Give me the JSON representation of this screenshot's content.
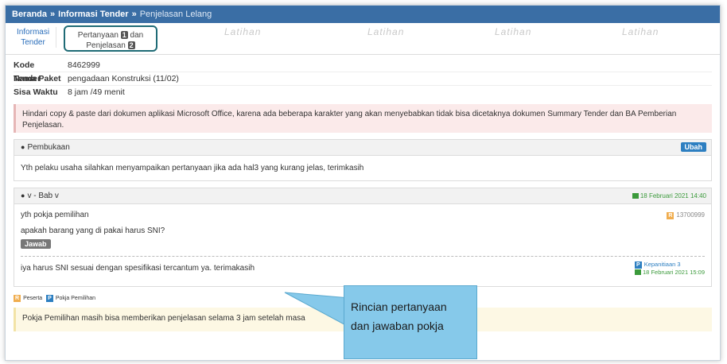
{
  "breadcrumb": {
    "home": "Beranda",
    "sep": "»",
    "level2": "Informasi Tender",
    "current": "Penjelasan Lelang"
  },
  "tabs": {
    "tab1_line1": "Informasi",
    "tab1_line2": "Tender",
    "tab2_pre": "Pertanyaan",
    "tab2_count1": "1",
    "tab2_mid": "dan",
    "tab2_line2": "Penjelasan",
    "tab2_count2": "2"
  },
  "watermark": "Latihan",
  "info": {
    "kode_label": "Kode Tender",
    "kode_value": "8462999",
    "paket_label": "Nama Paket",
    "paket_value": "pengadaan Konstruksi (11/02)",
    "waktu_label": "Sisa Waktu",
    "waktu_value": "8 jam /49 menit"
  },
  "alert_text": "Hindari copy & paste dari dokumen aplikasi Microsoft Office, karena ada beberapa karakter yang akan menyebabkan tidak bisa dicetaknya dokumen Summary Tender dan BA Pemberian Penjelasan.",
  "pembukaan": {
    "title": "Pembukaan",
    "edit_label": "Ubah",
    "text": "Yth pelaku usaha silahkan menyampaikan pertanyaan jika ada hal3 yang kurang jelas, terimkasih"
  },
  "thread": {
    "title": "v - Bab v",
    "date": "18 Februari 2021 14:40",
    "question_greeting": "yth pokja pemilihan",
    "user_badge": "R",
    "user_id": "13700999",
    "question": "apakah barang yang di pakai harus SNI?",
    "answer_button": "Jawab",
    "answer": "iya harus SNI sesuai dengan spesifikasi tercantum ya. terimakasih",
    "panitia_badge": "P",
    "panitia_name": "Kepanitiaan 3",
    "answer_date": "18 Februari 2021 15:09"
  },
  "legend": {
    "r_badge": "R",
    "r_label": "Peserta",
    "p_badge": "P",
    "p_label": "Pokja Pemilihan"
  },
  "note_text": "Pokja Pemilihan masih bisa memberikan penjelasan selama 3 jam setelah masa",
  "callout": {
    "line1": "Rincian pertanyaan",
    "line2": "dan jawaban pokja"
  },
  "colors": {
    "header_bg": "#3a6ea5",
    "highlight_border": "#1f6b76",
    "callout_bg": "#86c9ea"
  }
}
